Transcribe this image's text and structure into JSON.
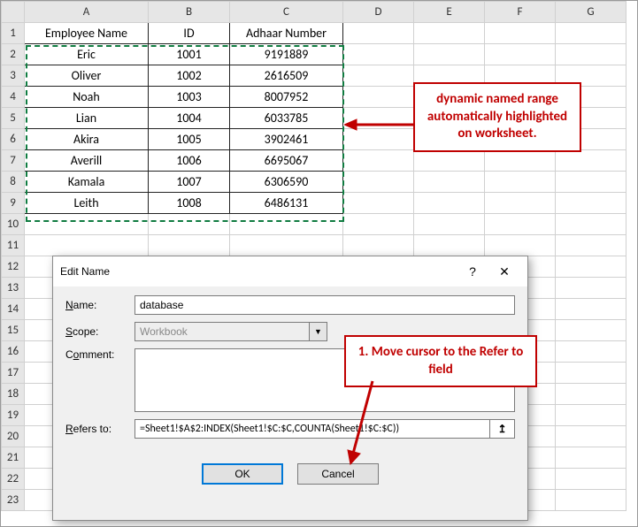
{
  "columns": [
    "A",
    "B",
    "C",
    "D",
    "E",
    "F",
    "G"
  ],
  "rows": [
    "1",
    "2",
    "3",
    "4",
    "5",
    "6",
    "7",
    "8",
    "9",
    "10",
    "11",
    "12",
    "13",
    "14",
    "15",
    "16",
    "17",
    "18",
    "19",
    "20",
    "21",
    "22",
    "23"
  ],
  "selectedCol": "B",
  "headers": {
    "A": "Employee Name",
    "B": "ID",
    "C": "Adhaar Number"
  },
  "data": [
    {
      "name": "Eric",
      "id": "1001",
      "adhaar": "9191889"
    },
    {
      "name": "Oliver",
      "id": "1002",
      "adhaar": "2616509"
    },
    {
      "name": "Noah",
      "id": "1003",
      "adhaar": "8007952"
    },
    {
      "name": "Lian",
      "id": "1004",
      "adhaar": "6033785"
    },
    {
      "name": "Akira",
      "id": "1005",
      "adhaar": "3902461"
    },
    {
      "name": "Averill",
      "id": "1006",
      "adhaar": "6695067"
    },
    {
      "name": "Kamala",
      "id": "1007",
      "adhaar": "6306590"
    },
    {
      "name": "Leith",
      "id": "1008",
      "adhaar": "6486131"
    }
  ],
  "callout1": "dynamic named range automatically highlighted on worksheet.",
  "callout2": "1. Move cursor to the Refer to field",
  "dialog": {
    "title": "Edit Name",
    "help": "?",
    "close": "✕",
    "labels": {
      "name": "Name:",
      "scope": "Scope:",
      "comment": "Comment:",
      "refers": "Refers to:"
    },
    "nameVal": "database",
    "scopeVal": "Workbook",
    "commentVal": "",
    "refersVal": "=Sheet1!$A$2:INDEX(Sheet1!$C:$C,COUNTA(Sheet1!$C:$C))",
    "ok": "OK",
    "cancel": "Cancel",
    "refIcon": "↥"
  }
}
